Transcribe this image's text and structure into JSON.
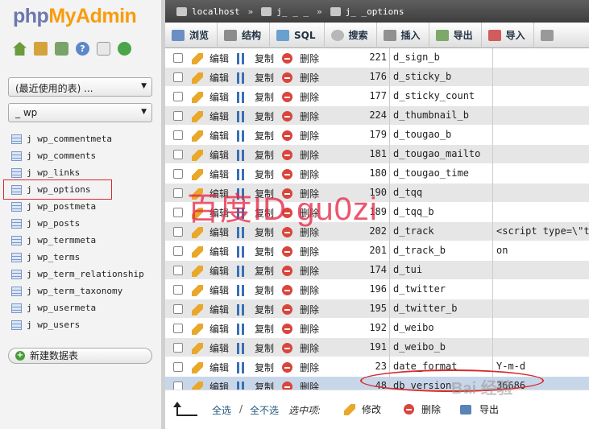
{
  "left": {
    "logo": {
      "part1": "php",
      "part2": "MyAdmin"
    },
    "recent_select": "(最近使用的表) ...",
    "db_select": "_ wp",
    "tables": [
      {
        "label": "j wp_commentmeta"
      },
      {
        "label": "j wp_comments"
      },
      {
        "label": "j wp_links"
      },
      {
        "label": "j wp_options"
      },
      {
        "label": "j wp_postmeta"
      },
      {
        "label": "j wp_posts"
      },
      {
        "label": "j wp_termmeta"
      },
      {
        "label": "j wp_terms"
      },
      {
        "label": "j wp_term_relationship"
      },
      {
        "label": "j wp_term_taxonomy"
      },
      {
        "label": "j wp_usermeta"
      },
      {
        "label": "j wp_users"
      }
    ],
    "selected_table_index": 3,
    "new_table": "新建数据表"
  },
  "breadcrumb": {
    "server": "localhost",
    "sep": "»",
    "database": "j_ _ _",
    "table": "j_ _options"
  },
  "tabs": [
    "浏览",
    "结构",
    "SQL",
    "搜索",
    "插入",
    "导出",
    "导入"
  ],
  "actions": {
    "edit": "编辑",
    "copy": "复制",
    "delete": "删除"
  },
  "rows": [
    {
      "id": "221",
      "name": "d_sign_b",
      "value": ""
    },
    {
      "id": "176",
      "name": "d_sticky_b",
      "value": ""
    },
    {
      "id": "177",
      "name": "d_sticky_count",
      "value": ""
    },
    {
      "id": "224",
      "name": "d_thumbnail_b",
      "value": ""
    },
    {
      "id": "179",
      "name": "d_tougao_b",
      "value": ""
    },
    {
      "id": "181",
      "name": "d_tougao_mailto",
      "value": ""
    },
    {
      "id": "180",
      "name": "d_tougao_time",
      "value": ""
    },
    {
      "id": "190",
      "name": "d_tqq",
      "value": ""
    },
    {
      "id": "189",
      "name": "d_tqq_b",
      "value": ""
    },
    {
      "id": "202",
      "name": "d_track",
      "value": "<script type=\\\"te"
    },
    {
      "id": "201",
      "name": "d_track_b",
      "value": "on"
    },
    {
      "id": "174",
      "name": "d_tui",
      "value": ""
    },
    {
      "id": "196",
      "name": "d_twitter",
      "value": ""
    },
    {
      "id": "195",
      "name": "d_twitter_b",
      "value": ""
    },
    {
      "id": "192",
      "name": "d_weibo",
      "value": ""
    },
    {
      "id": "191",
      "name": "d_weibo_b",
      "value": ""
    },
    {
      "id": "23",
      "name": "date_format",
      "value": "Y-m-d"
    },
    {
      "id": "48",
      "name": "db_version",
      "value": "36686"
    }
  ],
  "bottom": {
    "check_all": "全选",
    "sep": "/",
    "uncheck_all": "全不选",
    "with_selected": "选中项:",
    "modify": "修改",
    "delete": "删除",
    "export": "导出"
  },
  "watermark": "百度ID gu0zi",
  "baidu_mark": "Bai 经验"
}
